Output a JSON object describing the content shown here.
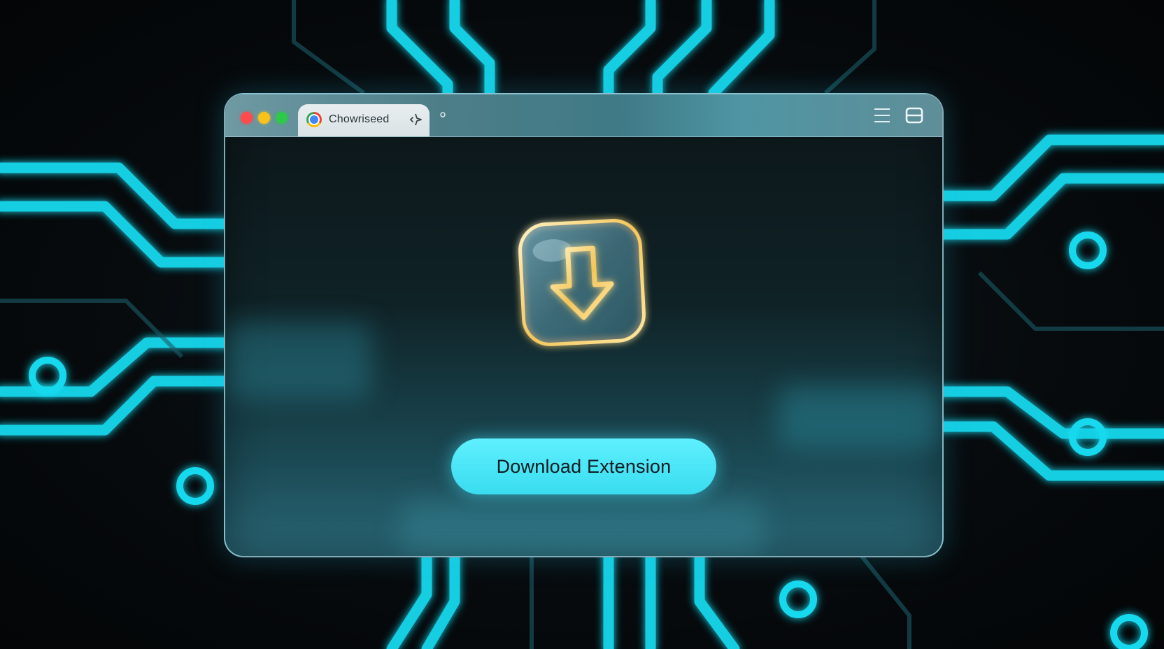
{
  "browser": {
    "tab": {
      "title": "Chowriseed",
      "favicon": "chrome-logo-icon",
      "action_icon": "sparkle-icon"
    },
    "toolbar": {
      "menu_icon": "hamburger-menu-icon",
      "layout_icon": "window-layout-icon"
    }
  },
  "content": {
    "hero_icon": "download-arrow-icon",
    "cta_label": "Download Extension"
  },
  "colors": {
    "accent_cyan": "#3fe4f5",
    "circuit_glow": "#17d9ee",
    "arrow_gold": "#f3c65a",
    "traffic_red": "#ff4b4b",
    "traffic_yellow": "#f7c31b",
    "traffic_green": "#2ec84a"
  }
}
